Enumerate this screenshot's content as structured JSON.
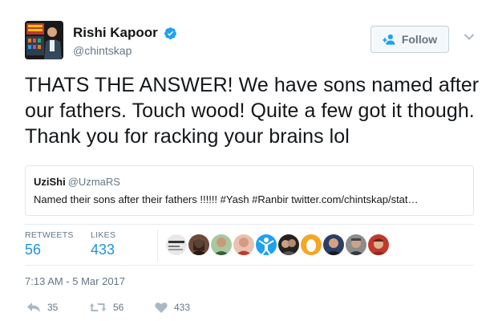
{
  "author": {
    "name": "Rishi Kapoor",
    "handle": "@chintskap",
    "verified": true
  },
  "follow_label": "Follow",
  "tweet_text": "THATS THE ANSWER! We have sons named after our fathers. Touch wood! Quite a few got it though. Thank you for racking your brains lol",
  "quoted_tweet": {
    "name": "UziShi",
    "handle": "@UzmaRS",
    "text": "Named their sons after their fathers !!!!!! #Yash #Ranbir twitter.com/chintskap/stat…"
  },
  "stats": {
    "retweets_label": "RETWEETS",
    "retweets": "56",
    "likes_label": "LIKES",
    "likes": "433"
  },
  "liker_avatar_count": 10,
  "timestamp": "7:13 AM - 5 Mar 2017",
  "actions": {
    "reply_count": "35",
    "retweet_count": "56",
    "like_count": "433"
  },
  "colors": {
    "link_blue": "#1c94e0",
    "verified_blue": "#1da1f2",
    "secondary_text": "#657786"
  }
}
